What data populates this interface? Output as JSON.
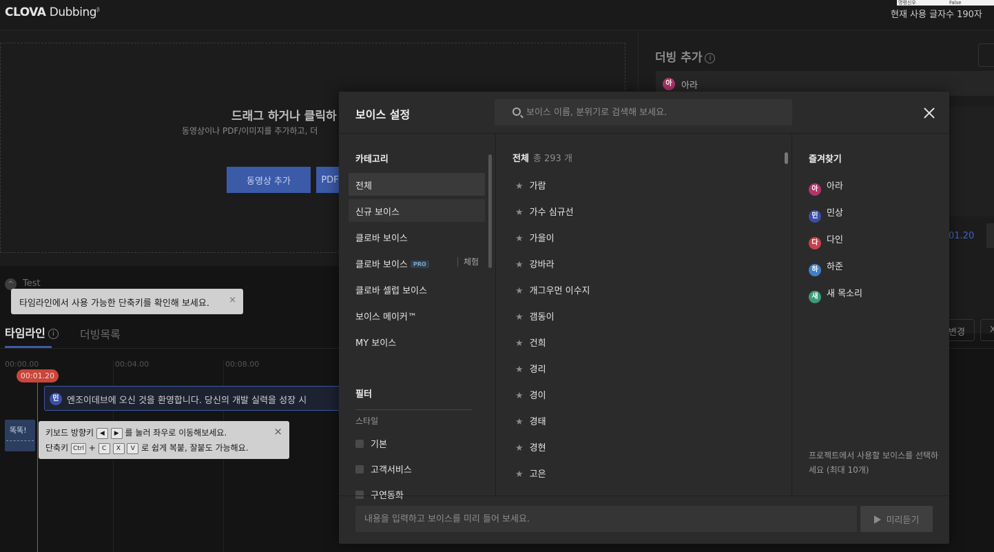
{
  "app": {
    "brand_bold": "CLOVA",
    "brand_light": "Dubbing",
    "brand_sup": "β",
    "debug_left": "명령신우",
    "debug_right": "False",
    "char_count": "현재 사용 글자수 190자"
  },
  "upload": {
    "title": "드래그 하거나 클릭하",
    "subtitle": "동영상이나 PDF/이미지를 추가하고, 더",
    "add_video": "동영상 추가",
    "add_pdf": "PDF"
  },
  "dubbing_panel": {
    "title": "더빙 추가",
    "info_icon": "i",
    "selected_voice": {
      "badge": "아",
      "name": "아라",
      "color": "#b0356b"
    },
    "time": "01.20"
  },
  "project": {
    "name": "Test",
    "collapse_icon": "^"
  },
  "tooltip_shortcut": {
    "text": "타임라인에서 사용 가능한 단축키를 확인해 보세요.",
    "close": "×"
  },
  "timeline": {
    "tab_timeline": "타임라인",
    "tab_list": "더빙목록",
    "change_btn": "변경",
    "change_btn2": "X",
    "ticks": [
      "00:00.00",
      "00:04.00",
      "00:08.00"
    ],
    "playhead": "00:01.20",
    "clip": {
      "badge": "민",
      "text": "엔조이데브에 오신 것을 환영합니다. 당신의 개발 실력을 성장 시",
      "color": "#3a4fa8"
    },
    "sound_clip": "똑똑!"
  },
  "tooltip_keys": {
    "line1_a": "키보드 방향키",
    "key_left": "◀",
    "key_right": "▶",
    "line1_b": "를 눌러 좌우로 이동해보세요.",
    "line2_a": "단축키",
    "key_ctrl": "Ctrl",
    "plus": "+",
    "key_c": "C",
    "key_x": "X",
    "key_v": "V",
    "line2_b": "로 쉽게 복붙, 잘붙도 가능해요.",
    "close": "×"
  },
  "modal": {
    "title": "보이스 설정",
    "search_placeholder": "보이스 이름, 분위기로 검색해 보세요.",
    "category_title": "카테고리",
    "categories": [
      {
        "label": "전체"
      },
      {
        "label": "신규 보이스"
      },
      {
        "label": "클로바 보이스"
      },
      {
        "label": "클로바 보이스",
        "badge": "PRO",
        "extra": "체험"
      },
      {
        "label": "클로바 셀럽 보이스"
      },
      {
        "label": "보이스 메이커™"
      },
      {
        "label": "MY 보이스"
      }
    ],
    "filter_title": "필터",
    "style_label": "스타일",
    "filters": [
      "기본",
      "고객서비스",
      "구연동화"
    ],
    "all_title": "전체",
    "all_count": "총 293 개",
    "voices": [
      "가람",
      "가수 심규선",
      "가을이",
      "강바라",
      "개그우먼 이수지",
      "갬동이",
      "건희",
      "경리",
      "경이",
      "경태",
      "경현",
      "고은"
    ],
    "favorites_title": "즐겨찾기",
    "favorites": [
      {
        "badge": "아",
        "name": "아라",
        "color": "#b0356b"
      },
      {
        "badge": "민",
        "name": "민상",
        "color": "#3a4fa8"
      },
      {
        "badge": "다",
        "name": "다인",
        "color": "#c8414a"
      },
      {
        "badge": "하",
        "name": "하준",
        "color": "#3f7fc4"
      },
      {
        "badge": "새",
        "name": "새 목소리",
        "color": "#3f9a78"
      }
    ],
    "fav_note": "프로젝트에서 사용할 보이스를 선택하세요 (최대 10개)",
    "preview_placeholder": "내용을 입력하고 보이스를 미리 들어 보세요.",
    "preview_button": "미리듣기"
  }
}
